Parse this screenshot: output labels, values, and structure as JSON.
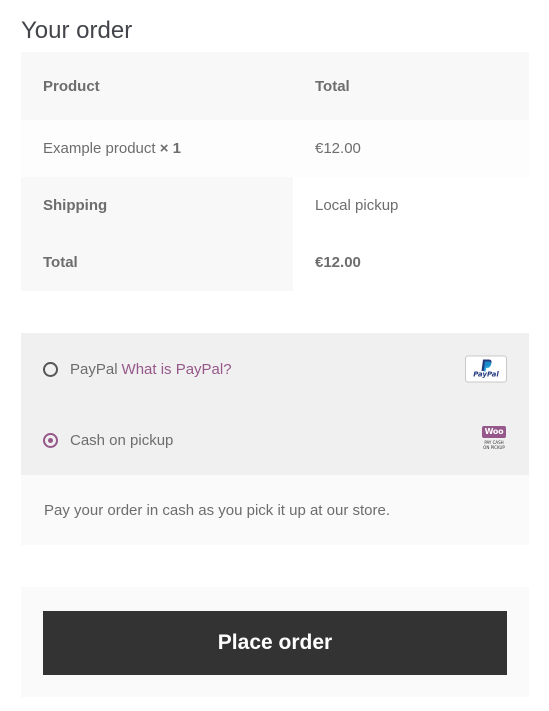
{
  "heading": "Your order",
  "order_table": {
    "headers": {
      "product": "Product",
      "total": "Total"
    },
    "item": {
      "name": "Example product",
      "quantity": "× 1",
      "price": "€12.00"
    },
    "shipping": {
      "label": "Shipping",
      "value": "Local pickup"
    },
    "total": {
      "label": "Total",
      "value": "€12.00"
    }
  },
  "payment": {
    "methods": [
      {
        "name": "PayPal",
        "link": "What is PayPal?",
        "selected": false,
        "icon": "paypal-logo-icon"
      },
      {
        "name": "Cash on pickup",
        "selected": true,
        "icon": "woo-pay-cash-icon"
      }
    ],
    "description": "Pay your order in cash as you pick it up at our store.",
    "woo_icon": {
      "top": "Woo",
      "lines": [
        "PAY CASH",
        "ON PICKUP"
      ]
    },
    "paypal_icon_text": "PayPal"
  },
  "place_order_label": "Place order",
  "colors": {
    "accent": "#96588a",
    "button": "#333333",
    "paypal_blue": "#253b80",
    "paypal_light": "#179bd7"
  }
}
